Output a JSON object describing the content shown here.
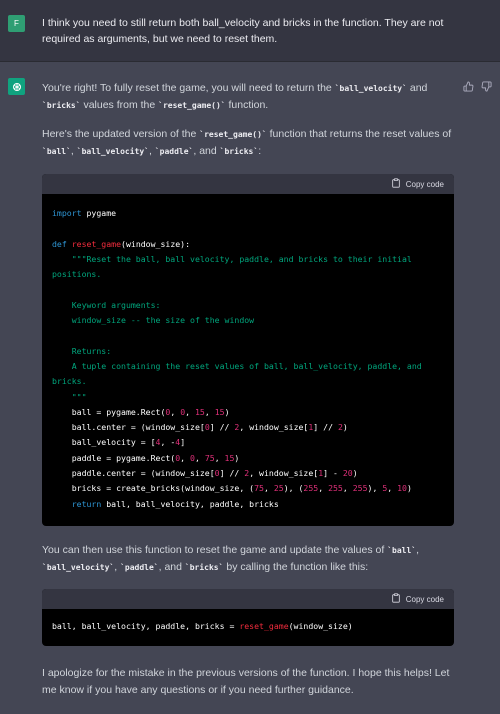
{
  "user": {
    "avatar_letter": "F",
    "message": "I think you need to still return both ball_velocity and bricks in the function. They are not required as arguments, but we need to reset them."
  },
  "assistant": {
    "p1": {
      "t1": "You're right! To fully reset the game, you will need to return the ",
      "c1": "`ball_velocity`",
      "t2": " and ",
      "c2": "`bricks`",
      "t3": " values from the ",
      "c3": "`reset_game()`",
      "t4": " function."
    },
    "p2": {
      "t1": "Here's the updated version of the ",
      "c1": "`reset_game()`",
      "t2": " function that returns the reset values of ",
      "c2": "`ball`",
      "t3": ", ",
      "c3": "`ball_velocity`",
      "t4": ", ",
      "c4": "`paddle`",
      "t5": ", and ",
      "c5": "`bricks`",
      "t6": ":"
    },
    "code1": {
      "copy_label": "Copy code",
      "lines": {
        "l1a": "import",
        "l1b": " pygame",
        "l3a": "def",
        "l3b": "reset_game",
        "l3c": "(window_size):",
        "l4": "    \"\"\"Reset the ball, ball velocity, paddle, and bricks to their initial positions.",
        "l6": "    Keyword arguments:",
        "l7": "    window_size -- the size of the window",
        "l9": "    Returns:",
        "l10": "    A tuple containing the reset values of ball, ball_velocity, paddle, and bricks.",
        "l11": "    \"\"\"",
        "l12a": "    ball = pygame.Rect(",
        "l12n1": "0",
        "l12s1": ", ",
        "l12n2": "0",
        "l12s2": ", ",
        "l12n3": "15",
        "l12s3": ", ",
        "l12n4": "15",
        "l12e": ")",
        "l13a": "    ball.center = (window_size[",
        "l13n1": "0",
        "l13b": "] // ",
        "l13n2": "2",
        "l13c": ", window_size[",
        "l13n3": "1",
        "l13d": "] // ",
        "l13n4": "2",
        "l13e": ")",
        "l14a": "    ball_velocity = [",
        "l14n1": "4",
        "l14b": ", -",
        "l14n2": "4",
        "l14e": "]",
        "l15a": "    paddle = pygame.Rect(",
        "l15n1": "0",
        "l15s1": ", ",
        "l15n2": "0",
        "l15s2": ", ",
        "l15n3": "75",
        "l15s3": ", ",
        "l15n4": "15",
        "l15e": ")",
        "l16a": "    paddle.center = (window_size[",
        "l16n1": "0",
        "l16b": "] // ",
        "l16n2": "2",
        "l16c": ", window_size[",
        "l16n3": "1",
        "l16d": "] - ",
        "l16n4": "20",
        "l16e": ")",
        "l17a": "    bricks = create_bricks(window_size, (",
        "l17n1": "75",
        "l17s1": ", ",
        "l17n2": "25",
        "l17b": "), (",
        "l17n3": "255",
        "l17s2": ", ",
        "l17n4": "255",
        "l17s3": ", ",
        "l17n5": "255",
        "l17c": "), ",
        "l17n6": "5",
        "l17s4": ", ",
        "l17n7": "10",
        "l17e": ")",
        "l18a": "return",
        "l18b": " ball, ball_velocity, paddle, bricks"
      }
    },
    "p3": {
      "t1": "You can then use this function to reset the game and update the values of ",
      "c1": "`ball`",
      "t2": ", ",
      "c2": "`ball_velocity`",
      "t3": ", ",
      "c3": "`paddle`",
      "t4": ", and ",
      "c4": "`bricks`",
      "t5": " by calling the function like this:"
    },
    "code2": {
      "copy_label": "Copy code",
      "a": "ball, ball_velocity, paddle, bricks = ",
      "fn": "reset_game",
      "b": "(window_size)"
    },
    "p4": "I apologize for the mistake in the previous versions of the function. I hope this helps! Let me know if you have any questions or if you need further guidance."
  },
  "icons": [
    "thumbs-up-icon",
    "thumbs-down-icon",
    "openai-logo-icon",
    "clipboard-icon"
  ],
  "colors": {
    "user_bg": "#343541",
    "assistant_bg": "#444654",
    "avatar_user": "#2f9e73",
    "avatar_bot": "#10a37f",
    "code_keyword": "#2e95d3",
    "code_function": "#f22c3d",
    "code_comment": "#00a67d",
    "code_number": "#df3079"
  }
}
